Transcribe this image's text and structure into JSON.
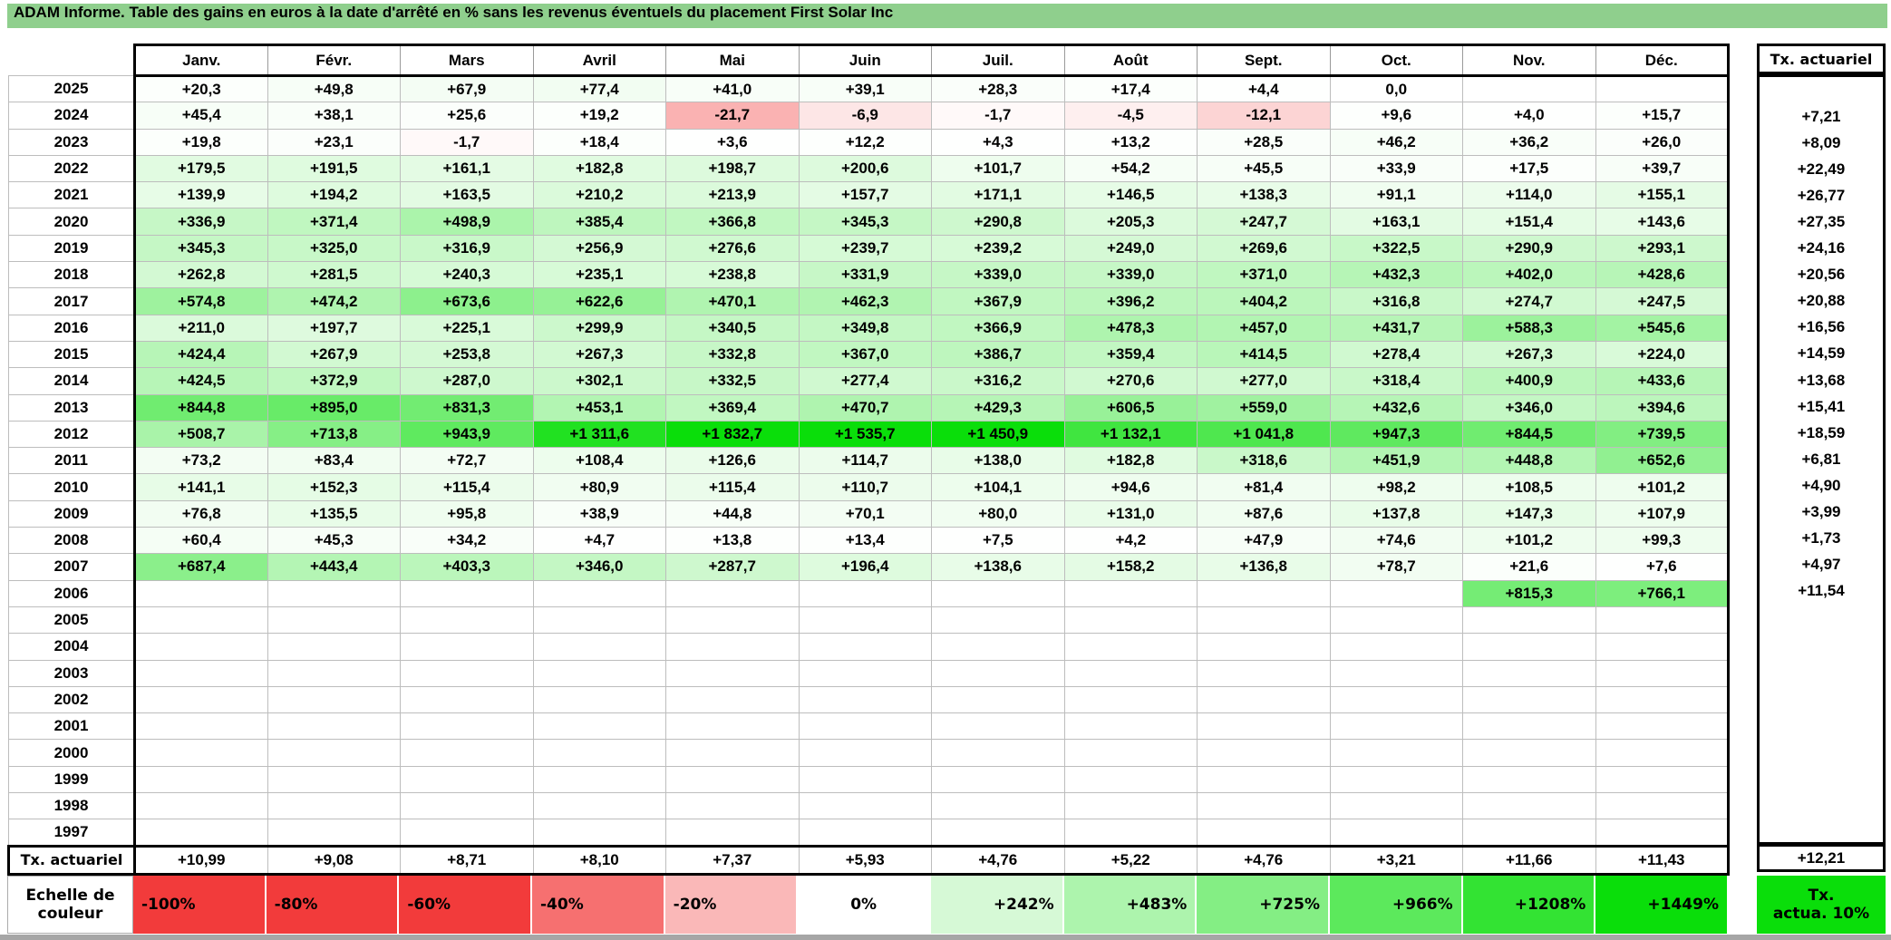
{
  "title": "ADAM Informe. Table des gains en euros à la date d'arrêté en % sans les revenus éventuels du placement First Solar Inc",
  "colors": {
    "title_bar": "#8fcf8d",
    "grid_line": "#bdbdbd",
    "thick_border": "#000000",
    "full_green": "#0ade0a",
    "full_red": "#f23b3b",
    "bottom_strip": "#a6a6a6",
    "scale_tx_box_green": "#0ae00a"
  },
  "color_mapping": {
    "green_max_value": 1449,
    "red_min_value": -55
  },
  "table": {
    "months": [
      "Janv.",
      "Févr.",
      "Mars",
      "Avril",
      "Mai",
      "Juin",
      "Juil.",
      "Août",
      "Sept.",
      "Oct.",
      "Nov.",
      "Déc."
    ],
    "rows": [
      {
        "year": "2025",
        "cells": [
          "+20,3",
          "+49,8",
          "+67,9",
          "+77,4",
          "+41,0",
          "+39,1",
          "+28,3",
          "+17,4",
          "+4,4",
          "0,0",
          "",
          ""
        ],
        "tx": ""
      },
      {
        "year": "2024",
        "cells": [
          "+45,4",
          "+38,1",
          "+25,6",
          "+19,2",
          "-21,7",
          "-6,9",
          "-1,7",
          "-4,5",
          "-12,1",
          "+9,6",
          "+4,0",
          "+15,7"
        ],
        "tx": "+7,21"
      },
      {
        "year": "2023",
        "cells": [
          "+19,8",
          "+23,1",
          "-1,7",
          "+18,4",
          "+3,6",
          "+12,2",
          "+4,3",
          "+13,2",
          "+28,5",
          "+46,2",
          "+36,2",
          "+26,0"
        ],
        "tx": "+8,09"
      },
      {
        "year": "2022",
        "cells": [
          "+179,5",
          "+191,5",
          "+161,1",
          "+182,8",
          "+198,7",
          "+200,6",
          "+101,7",
          "+54,2",
          "+45,5",
          "+33,9",
          "+17,5",
          "+39,7"
        ],
        "tx": "+22,49"
      },
      {
        "year": "2021",
        "cells": [
          "+139,9",
          "+194,2",
          "+163,5",
          "+210,2",
          "+213,9",
          "+157,7",
          "+171,1",
          "+146,5",
          "+138,3",
          "+91,1",
          "+114,0",
          "+155,1"
        ],
        "tx": "+26,77"
      },
      {
        "year": "2020",
        "cells": [
          "+336,9",
          "+371,4",
          "+498,9",
          "+385,4",
          "+366,8",
          "+345,3",
          "+290,8",
          "+205,3",
          "+247,7",
          "+163,1",
          "+151,4",
          "+143,6"
        ],
        "tx": "+27,35"
      },
      {
        "year": "2019",
        "cells": [
          "+345,3",
          "+325,0",
          "+316,9",
          "+256,9",
          "+276,6",
          "+239,7",
          "+239,2",
          "+249,0",
          "+269,6",
          "+322,5",
          "+290,9",
          "+293,1"
        ],
        "tx": "+24,16"
      },
      {
        "year": "2018",
        "cells": [
          "+262,8",
          "+281,5",
          "+240,3",
          "+235,1",
          "+238,8",
          "+331,9",
          "+339,0",
          "+339,0",
          "+371,0",
          "+432,3",
          "+402,0",
          "+428,6"
        ],
        "tx": "+20,56"
      },
      {
        "year": "2017",
        "cells": [
          "+574,8",
          "+474,2",
          "+673,6",
          "+622,6",
          "+470,1",
          "+462,3",
          "+367,9",
          "+396,2",
          "+404,2",
          "+316,8",
          "+274,7",
          "+247,5"
        ],
        "tx": "+20,88"
      },
      {
        "year": "2016",
        "cells": [
          "+211,0",
          "+197,7",
          "+225,1",
          "+299,9",
          "+340,5",
          "+349,8",
          "+366,9",
          "+478,3",
          "+457,0",
          "+431,7",
          "+588,3",
          "+545,6"
        ],
        "tx": "+16,56"
      },
      {
        "year": "2015",
        "cells": [
          "+424,4",
          "+267,9",
          "+253,8",
          "+267,3",
          "+332,8",
          "+367,0",
          "+386,7",
          "+359,4",
          "+414,5",
          "+278,4",
          "+267,3",
          "+224,0"
        ],
        "tx": "+14,59"
      },
      {
        "year": "2014",
        "cells": [
          "+424,5",
          "+372,9",
          "+287,0",
          "+302,1",
          "+332,5",
          "+277,4",
          "+316,2",
          "+270,6",
          "+277,0",
          "+318,4",
          "+400,9",
          "+433,6"
        ],
        "tx": "+13,68"
      },
      {
        "year": "2013",
        "cells": [
          "+844,8",
          "+895,0",
          "+831,3",
          "+453,1",
          "+369,4",
          "+470,7",
          "+429,3",
          "+606,5",
          "+559,0",
          "+432,6",
          "+346,0",
          "+394,6"
        ],
        "tx": "+15,41"
      },
      {
        "year": "2012",
        "cells": [
          "+508,7",
          "+713,8",
          "+943,9",
          "+1 311,6",
          "+1 832,7",
          "+1 535,7",
          "+1 450,9",
          "+1 132,1",
          "+1 041,8",
          "+947,3",
          "+844,5",
          "+739,5"
        ],
        "tx": "+18,59"
      },
      {
        "year": "2011",
        "cells": [
          "+73,2",
          "+83,4",
          "+72,7",
          "+108,4",
          "+126,6",
          "+114,7",
          "+138,0",
          "+182,8",
          "+318,6",
          "+451,9",
          "+448,8",
          "+652,6"
        ],
        "tx": "+6,81"
      },
      {
        "year": "2010",
        "cells": [
          "+141,1",
          "+152,3",
          "+115,4",
          "+80,9",
          "+115,4",
          "+110,7",
          "+104,1",
          "+94,6",
          "+81,4",
          "+98,2",
          "+108,5",
          "+101,2"
        ],
        "tx": "+4,90"
      },
      {
        "year": "2009",
        "cells": [
          "+76,8",
          "+135,5",
          "+95,8",
          "+38,9",
          "+44,8",
          "+70,1",
          "+80,0",
          "+131,0",
          "+87,6",
          "+137,8",
          "+147,3",
          "+107,9"
        ],
        "tx": "+3,99"
      },
      {
        "year": "2008",
        "cells": [
          "+60,4",
          "+45,3",
          "+34,2",
          "+4,7",
          "+13,8",
          "+13,4",
          "+7,5",
          "+4,2",
          "+47,9",
          "+74,6",
          "+101,2",
          "+99,3"
        ],
        "tx": "+1,73"
      },
      {
        "year": "2007",
        "cells": [
          "+687,4",
          "+443,4",
          "+403,3",
          "+346,0",
          "+287,7",
          "+196,4",
          "+138,6",
          "+158,2",
          "+136,8",
          "+78,7",
          "+21,6",
          "+7,6"
        ],
        "tx": "+4,97"
      },
      {
        "year": "2006",
        "cells": [
          "",
          "",
          "",
          "",
          "",
          "",
          "",
          "",
          "",
          "",
          "+815,3",
          "+766,1"
        ],
        "tx": "+11,54"
      },
      {
        "year": "2005",
        "cells": [
          "",
          "",
          "",
          "",
          "",
          "",
          "",
          "",
          "",
          "",
          "",
          ""
        ],
        "tx": ""
      },
      {
        "year": "2004",
        "cells": [
          "",
          "",
          "",
          "",
          "",
          "",
          "",
          "",
          "",
          "",
          "",
          ""
        ],
        "tx": ""
      },
      {
        "year": "2003",
        "cells": [
          "",
          "",
          "",
          "",
          "",
          "",
          "",
          "",
          "",
          "",
          "",
          ""
        ],
        "tx": ""
      },
      {
        "year": "2002",
        "cells": [
          "",
          "",
          "",
          "",
          "",
          "",
          "",
          "",
          "",
          "",
          "",
          ""
        ],
        "tx": ""
      },
      {
        "year": "2001",
        "cells": [
          "",
          "",
          "",
          "",
          "",
          "",
          "",
          "",
          "",
          "",
          "",
          ""
        ],
        "tx": ""
      },
      {
        "year": "2000",
        "cells": [
          "",
          "",
          "",
          "",
          "",
          "",
          "",
          "",
          "",
          "",
          "",
          ""
        ],
        "tx": ""
      },
      {
        "year": "1999",
        "cells": [
          "",
          "",
          "",
          "",
          "",
          "",
          "",
          "",
          "",
          "",
          "",
          ""
        ],
        "tx": ""
      },
      {
        "year": "1998",
        "cells": [
          "",
          "",
          "",
          "",
          "",
          "",
          "",
          "",
          "",
          "",
          "",
          ""
        ],
        "tx": ""
      },
      {
        "year": "1997",
        "cells": [
          "",
          "",
          "",
          "",
          "",
          "",
          "",
          "",
          "",
          "",
          "",
          ""
        ],
        "tx": ""
      }
    ],
    "footer": {
      "label": "Tx. actuariel",
      "cells": [
        "+10,99",
        "+9,08",
        "+8,71",
        "+8,10",
        "+7,37",
        "+5,93",
        "+4,76",
        "+5,22",
        "+4,76",
        "+3,21",
        "+11,66",
        "+11,43"
      ]
    }
  },
  "right_column": {
    "header": "Tx. actuariel",
    "footer": "+12,21"
  },
  "selection": {
    "year": "2025",
    "month_index": 0
  },
  "scale_row": {
    "label_line1": "Echelle de",
    "label_line2": "couleur",
    "cells": [
      {
        "label": "-100%",
        "value": -100,
        "align": "left"
      },
      {
        "label": "-80%",
        "value": -80,
        "align": "left"
      },
      {
        "label": "-60%",
        "value": -60,
        "align": "left"
      },
      {
        "label": "-40%",
        "value": -40,
        "align": "left"
      },
      {
        "label": "-20%",
        "value": -20,
        "align": "left"
      },
      {
        "label": "0%",
        "value": 0,
        "align": "center"
      },
      {
        "label": "+242%",
        "value": 242,
        "align": "right"
      },
      {
        "label": "+483%",
        "value": 483,
        "align": "right"
      },
      {
        "label": "+725%",
        "value": 725,
        "align": "right"
      },
      {
        "label": "+966%",
        "value": 966,
        "align": "right"
      },
      {
        "label": "+1208%",
        "value": 1208,
        "align": "right"
      },
      {
        "label": "+1449%",
        "value": 1449,
        "align": "right"
      }
    ],
    "tx_box": {
      "line1": "Tx.",
      "line2": "actua. 10%",
      "value": 1449
    }
  }
}
